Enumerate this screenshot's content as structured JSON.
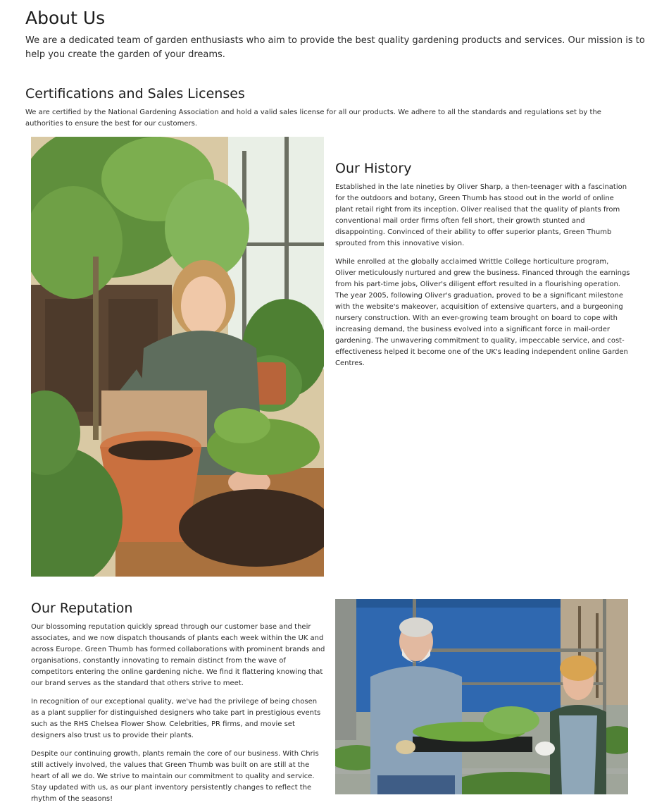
{
  "about": {
    "title": "About Us",
    "text": "We are a dedicated team of garden enthusiasts who aim to provide the best quality gardening products and services. Our mission is to help you create the garden of your dreams."
  },
  "certifications": {
    "title": "Certifications and Sales Licenses",
    "text": "We are certified by the National Gardening Association and hold a valid sales license for all our products. We adhere to all the standards and regulations set by the authorities to ensure the best for our customers."
  },
  "history": {
    "title": "Our History",
    "paragraphs": [
      "Established in the late nineties by Oliver Sharp, a then-teenager with a fascination for the outdoors and botany, Green Thumb has stood out in the world of online plant retail right from its inception. Oliver realised that the quality of plants from conventional mail order firms often fell short, their growth stunted and disappointing. Convinced of their ability to offer superior plants, Green Thumb sprouted from this innovative vision.",
      "While enrolled at the globally acclaimed Writtle College horticulture program, Oliver meticulously nurtured and grew the business. Financed through the earnings from his part-time jobs, Oliver's diligent effort resulted in a flourishing operation. The year 2005, following Oliver's graduation, proved to be a significant milestone with the website's makeover, acquisition of extensive quarters, and a burgeoning nursery construction. With an ever-growing team brought on board to cope with increasing demand, the business evolved into a significant force in mail-order gardening. The unwavering commitment to quality, impeccable service, and cost-effectiveness helped it become one of the UK's leading independent online Garden Centres."
    ]
  },
  "reputation": {
    "title": "Our Reputation",
    "paragraphs": [
      "Our blossoming reputation quickly spread through our customer base and their associates, and we now dispatch thousands of plants each week within the UK and across Europe. Green Thumb has formed collaborations with prominent brands and organisations, constantly innovating to remain distinct from the wave of competitors entering the online gardening niche. We find it flattering knowing that our brand serves as the standard that others strive to meet.",
      "In recognition of our exceptional quality, we've had the privilege of being chosen as a plant supplier for distinguished designers who take part in prestigious events such as the RHS Chelsea Flower Show. Celebrities, PR firms, and movie set designers also trust us to provide their plants.",
      "Despite our continuing growth, plants remain the core of our business. With Chris still actively involved, the values that Green Thumb was built on are still at the heart of all we do. We strive to maintain our commitment to quality and service. Stay updated with us, as our plant inventory persistently changes to reflect the rhythm of the seasons!"
    ]
  },
  "images": {
    "history_photo": "woman-repotting-fern-photo",
    "reputation_photo": "gardeners-holding-seedling-tray-photo"
  }
}
